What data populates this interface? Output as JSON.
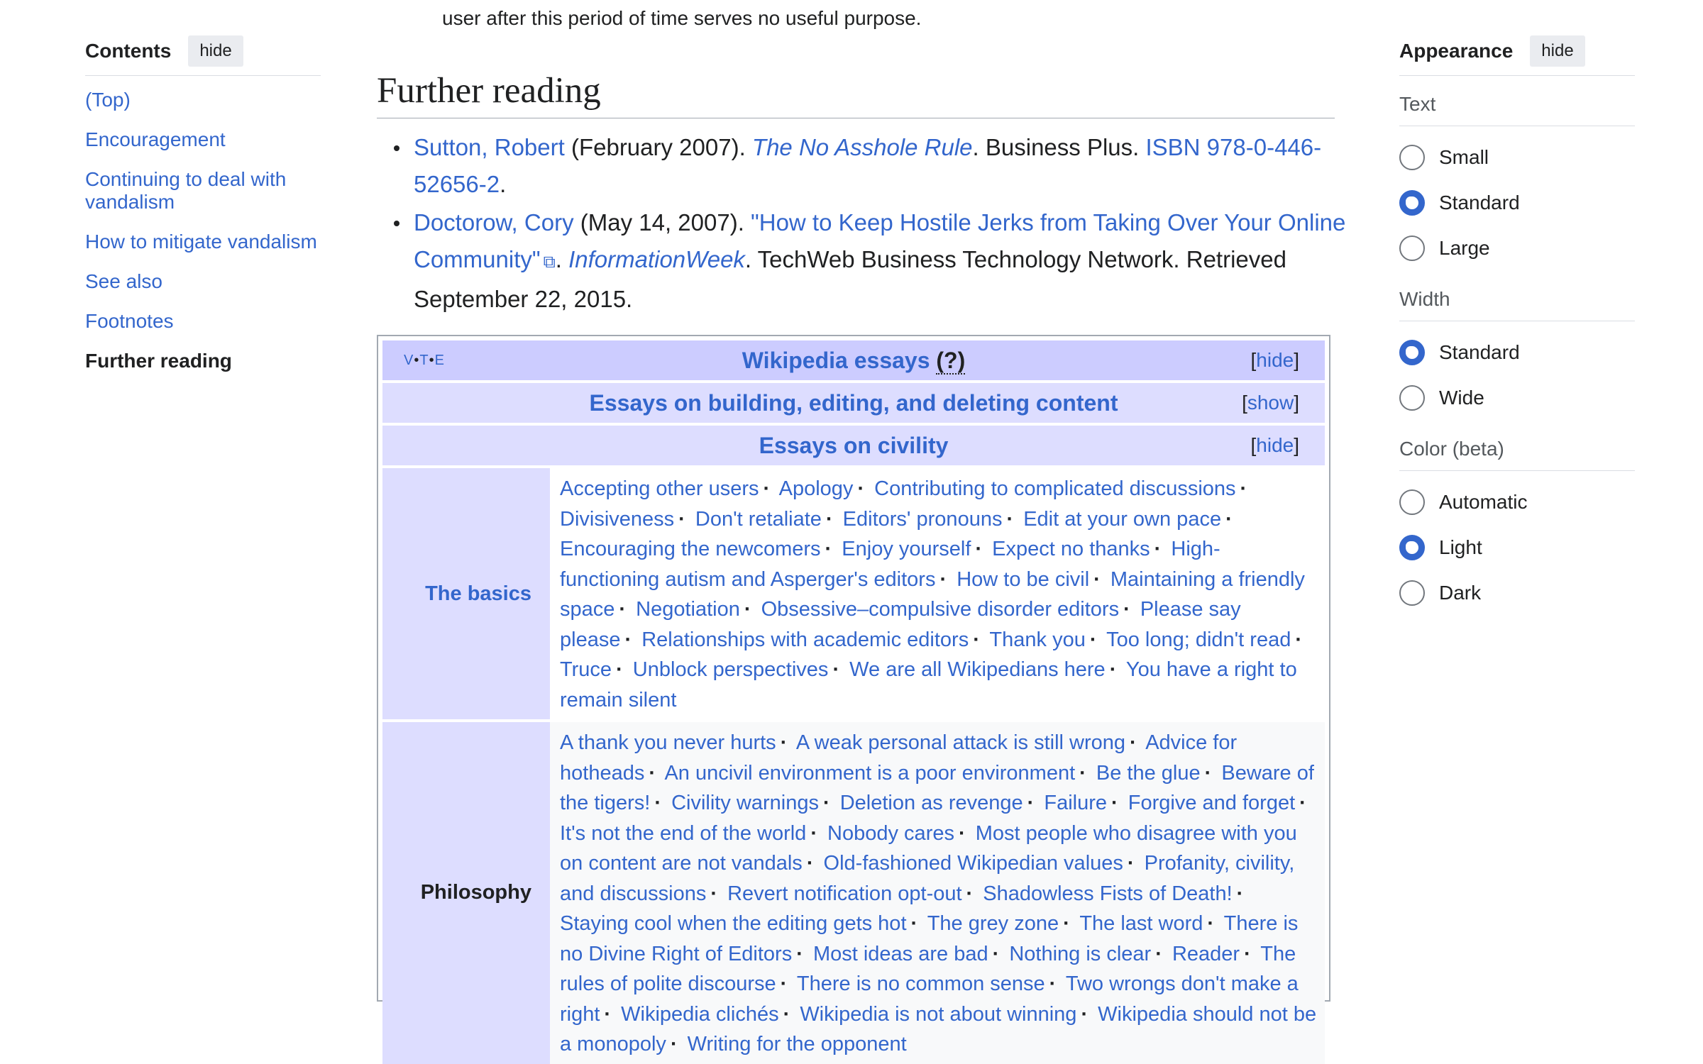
{
  "toc": {
    "title": "Contents",
    "hide_label": "hide",
    "items": [
      {
        "label": "(Top)"
      },
      {
        "label": "Encouragement"
      },
      {
        "label": "Continuing to deal with vandalism"
      },
      {
        "label": "How to mitigate vandalism"
      },
      {
        "label": "See also"
      },
      {
        "label": "Footnotes"
      },
      {
        "label": "Further reading",
        "current": true
      }
    ]
  },
  "main": {
    "intro_tail": "user after this period of time serves no useful purpose.",
    "section_title": "Further reading",
    "references": [
      {
        "author": "Sutton, Robert",
        "date": " (February 2007). ",
        "work": "The No Asshole Rule",
        "publisher": ". Business Plus. ",
        "isbn": "ISBN 978-0-446-52656-2",
        "end": "."
      },
      {
        "author": "Doctorow, Cory",
        "date": " (May 14, 2007). ",
        "title": "\"How to Keep Hostile Jerks from Taking Over Your Online Community\"",
        "sep": ". ",
        "work": "InformationWeek",
        "publisher": ". TechWeb Business Technology Network. Retrieved September 22, 2015."
      }
    ]
  },
  "navbox": {
    "vte": [
      "V",
      "T",
      "E"
    ],
    "title": "Wikipedia essays",
    "title_q": "(?)",
    "title_toggle": "hide",
    "groups": [
      {
        "label": "Essays on building, editing, and deleting content",
        "toggle": "show"
      },
      {
        "label": "Essays on civility",
        "toggle": "hide"
      }
    ],
    "subgroups": [
      {
        "label": "The basics",
        "links": [
          "Accepting other users",
          "Apology",
          "Contributing to complicated discussions",
          "Divisiveness",
          "Don't retaliate",
          "Editors' pronouns",
          "Edit at your own pace",
          "Encouraging the newcomers",
          "Enjoy yourself",
          "Expect no thanks",
          "High-functioning autism and Asperger's editors",
          "How to be civil",
          "Maintaining a friendly space",
          "Negotiation",
          "Obsessive–compulsive disorder editors",
          "Please say please",
          "Relationships with academic editors",
          "Thank you",
          "Too long; didn't read",
          "Truce",
          "Unblock perspectives",
          "We are all Wikipedians here",
          "You have a right to remain silent"
        ]
      },
      {
        "label": "Philosophy",
        "links": [
          "A thank you never hurts",
          "A weak personal attack is still wrong",
          "Advice for hotheads",
          "An uncivil environment is a poor environment",
          "Be the glue",
          "Beware of the tigers!",
          "Civility warnings",
          "Deletion as revenge",
          "Failure",
          "Forgive and forget",
          "It's not the end of the world",
          "Nobody cares",
          "Most people who disagree with you on content are not vandals",
          "Old-fashioned Wikipedian values",
          "Profanity, civility, and discussions",
          "Revert notification opt-out",
          "Shadowless Fists of Death!",
          "Staying cool when the editing gets hot",
          "The grey zone",
          "The last word",
          "There is no Divine Right of Editors",
          "Most ideas are bad",
          "Nothing is clear",
          "Reader",
          "The rules of polite discourse",
          "There is no common sense",
          "Two wrongs don't make a right",
          "Wikipedia clichés",
          "Wikipedia is not about winning",
          "Wikipedia should not be a monopoly",
          "Writing for the opponent"
        ]
      }
    ]
  },
  "appearance": {
    "title": "Appearance",
    "hide_label": "hide",
    "sections": [
      {
        "label": "Text",
        "options": [
          {
            "label": "Small",
            "checked": false
          },
          {
            "label": "Standard",
            "checked": true
          },
          {
            "label": "Large",
            "checked": false
          }
        ]
      },
      {
        "label": "Width",
        "options": [
          {
            "label": "Standard",
            "checked": true
          },
          {
            "label": "Wide",
            "checked": false
          }
        ]
      },
      {
        "label": "Color (beta)",
        "options": [
          {
            "label": "Automatic",
            "checked": false
          },
          {
            "label": "Light",
            "checked": true
          },
          {
            "label": "Dark",
            "checked": false
          }
        ]
      }
    ]
  }
}
